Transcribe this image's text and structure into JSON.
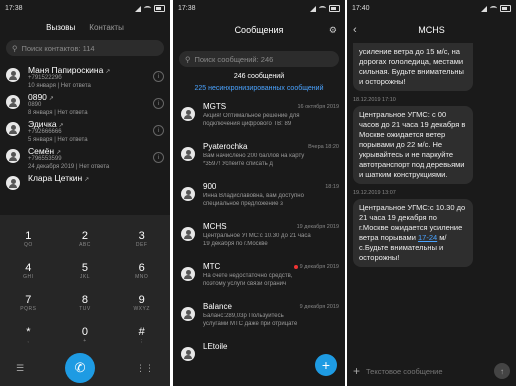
{
  "phone": {
    "status_time": "17:38",
    "tabs": [
      "Вызовы",
      "Контакты"
    ],
    "search_placeholder": "Поиск контактов: 114",
    "contacts": [
      {
        "name": "Маня Папироскина",
        "line1": "+79152229б",
        "line2": "10 января | Нет ответа"
      },
      {
        "name": "0890",
        "line1": "0890",
        "line2": "8 января | Нет ответа"
      },
      {
        "name": "Эдичка",
        "line1": "+792666666",
        "line2": "5 января | Нет ответа"
      },
      {
        "name": "Семён",
        "line1": "+796553599",
        "line2": "24 декабря 2019 | Нет ответа"
      },
      {
        "name": "Клара Цеткин",
        "line1": "",
        "line2": ""
      }
    ],
    "keys": [
      {
        "d": "1",
        "l": "QO"
      },
      {
        "d": "2",
        "l": "ABC"
      },
      {
        "d": "3",
        "l": "DEF"
      },
      {
        "d": "4",
        "l": "GHI"
      },
      {
        "d": "5",
        "l": "JKL"
      },
      {
        "d": "6",
        "l": "MNO"
      },
      {
        "d": "7",
        "l": "PQRS"
      },
      {
        "d": "8",
        "l": "TUV"
      },
      {
        "d": "9",
        "l": "WXYZ"
      },
      {
        "d": "*",
        "l": ","
      },
      {
        "d": "0",
        "l": "+"
      },
      {
        "d": "#",
        "l": ";"
      }
    ]
  },
  "messages": {
    "status_time": "17:38",
    "title": "Сообщения",
    "search_placeholder": "Поиск сообщений: 246",
    "count_text": "246 сообщений",
    "unsorted_text": "225 несинхронизированных сообщений",
    "threads": [
      {
        "name": "MGTS",
        "date": "16 октября 2019",
        "line1": "Акция! Оптимальное решение для",
        "line2": "подключения цифрового ТВ: 89",
        "unread": false
      },
      {
        "name": "Pyaterochka",
        "date": "Вчера 18:20",
        "line1": "Вам начислено 200 баллов на карту",
        "line2": "*3597! Успейте списать д",
        "unread": false
      },
      {
        "name": "900",
        "date": "18:19",
        "line1": "Инна Владиславовна, вам доступно",
        "line2": "специальное предложение з",
        "unread": false
      },
      {
        "name": "MCHS",
        "date": "19 декабря 2019",
        "line1": "Центральное УГМС:с 10.30 до 21 часа",
        "line2": "19 декабря по г.Москве",
        "unread": false
      },
      {
        "name": "MTC",
        "date": "9 декабря 2019",
        "line1": "На счете недостаточно средств,",
        "line2": "поэтому услуги связи огранич",
        "unread": true
      },
      {
        "name": "Balance",
        "date": "9 декабря 2019",
        "line1": "Баланс:289,03р Пользуйтесь",
        "line2": "услугами МТС даже при отрицате",
        "unread": false
      },
      {
        "name": "LEtoile",
        "date": "",
        "line1": "",
        "line2": "",
        "unread": false
      }
    ]
  },
  "chat": {
    "status_time": "17:40",
    "title": "MCHS",
    "input_placeholder": "Текстовое сообщение",
    "bubble1": "усиление ветра до 15 м/с, на дорогах гололедица, местами сильная. Будьте внимательны и осторожны!",
    "ts1": "18.12.2019 17:10",
    "bubble2": "Центральное УГМС: с 00 часов до 21 часа 19 декабря в Москве ожидается ветер порывами до 22 м/с. Не укрывайтесь и не паркуйте автотранспорт под деревьями и шатким конструкциями.",
    "ts2": "19.12.2019 13:07",
    "bubble3_pre": "Центральное УГМС:с 10.30 до 21 часа 19 декабря по г.Москве ожидается усиление ветра порывами ",
    "bubble3_link": "17-24",
    "bubble3_post": " м/с.Будьте внимательны и осторожны!"
  }
}
